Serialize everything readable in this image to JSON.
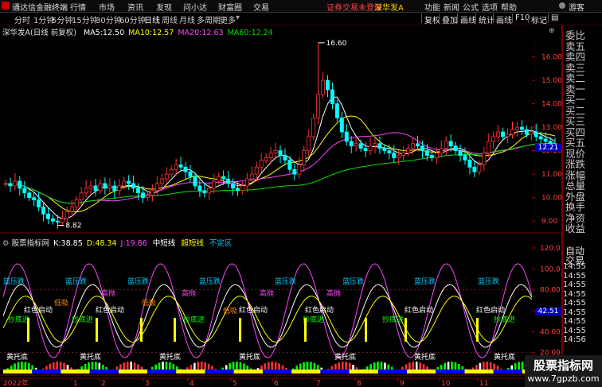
{
  "topbar": {
    "app_title": "通达信金融终端",
    "menus": [
      "行情",
      "市场",
      "资讯",
      "发现",
      "问小达",
      "财富圈",
      "交易"
    ],
    "notice": "证券交易未登录",
    "stock_short": "深华发A",
    "right_menus": [
      "功能",
      "新闻",
      "公式",
      "选项",
      "帮助",
      "游客"
    ]
  },
  "toolbar": {
    "periods": [
      "分时",
      "1分钟",
      "5分钟",
      "15分钟",
      "30分钟",
      "60分钟",
      "日线",
      "周线",
      "月线",
      "多周期",
      "更多"
    ],
    "active_period": "日线",
    "right_buttons": [
      "复权",
      "叠加",
      "画线",
      "统计",
      "画线",
      "F10",
      "标记"
    ]
  },
  "main_info": {
    "stock": "深华发A(日线 前复权)",
    "ma5_label": "MA5:",
    "ma5": "12.50",
    "ma10_label": "MA10:",
    "ma10": "12.57",
    "ma20_label": "MA20:",
    "ma20": "12.63",
    "ma60_label": "MA60:",
    "ma60": "12.24"
  },
  "sub_info": {
    "indicator": "股票指标网",
    "k_label": "K:",
    "k": "38.85",
    "d_label": "D:",
    "d": "48.34",
    "j_label": "J:",
    "j": "19.86",
    "mid": "中短线",
    "super": "超短线",
    "zone": "不定区"
  },
  "price_axis": [
    "16.00",
    "15.00",
    "14.00",
    "13.00",
    "12.00",
    "11.00",
    "10.00",
    "9.00"
  ],
  "kdj_axis": [
    "120.0",
    "100.0",
    "80.00",
    "60.00",
    "40.00",
    "20.00",
    "0.00"
  ],
  "current_price_tag": "12.21",
  "kdj_value_tag": "42.51",
  "high_label": "16.60",
  "low_label": "8.82",
  "date_axis": [
    "2022年",
    "1",
    "2",
    "3",
    "4",
    "5",
    "6",
    "7",
    "8",
    "9",
    "10",
    "11"
  ],
  "annotations": {
    "start": "红色启动",
    "low": "低吸",
    "top": "高抛",
    "lower_support": "黄托底",
    "pressure": "蓝压跌",
    "cut": "抄底进"
  },
  "right_panel": {
    "labels": [
      "委比",
      "卖五",
      "卖四",
      "卖三",
      "卖二",
      "卖一",
      "买一",
      "买二",
      "买三",
      "买四",
      "买五",
      "现价",
      "涨跌",
      "涨幅",
      "总量",
      "外盘",
      "换手",
      "净资",
      "收益"
    ],
    "bottom_labels": [
      "自动",
      "交易",
      "14:55",
      "14:55",
      "14:55",
      "14:55",
      "14:55",
      "14:55",
      "14:55",
      "14:55",
      "14:56"
    ]
  },
  "watermark": {
    "title": "股票指标网",
    "url": "www.7gpzb.com"
  },
  "chart_data": {
    "type": "candlestick",
    "title": "深华发A(日线 前复权)",
    "ylim": [
      8.6,
      16.9
    ],
    "x_categories": [
      "2022年",
      "1",
      "2",
      "3",
      "4",
      "5",
      "6",
      "7",
      "8",
      "9",
      "10",
      "11"
    ],
    "max_marker": 16.6,
    "min_marker": 8.82,
    "close_series": [
      10.6,
      10.5,
      10.7,
      10.4,
      10.2,
      10.0,
      9.9,
      9.6,
      9.3,
      9.1,
      9.0,
      8.95,
      9.1,
      9.4,
      9.6,
      9.9,
      10.2,
      10.4,
      10.5,
      10.3,
      10.6,
      10.4,
      10.5,
      10.3,
      10.5,
      10.7,
      10.6,
      10.4,
      10.2,
      10.0,
      10.1,
      10.3,
      10.6,
      10.8,
      11.0,
      11.2,
      11.4,
      11.3,
      11.1,
      10.9,
      10.5,
      10.3,
      10.2,
      10.4,
      10.7,
      10.9,
      10.8,
      10.6,
      10.4,
      10.3,
      10.5,
      10.8,
      11.0,
      11.3,
      11.6,
      11.7,
      11.9,
      12.0,
      11.8,
      11.6,
      11.2,
      11.0,
      11.4,
      12.0,
      12.6,
      13.4,
      14.4,
      15.0,
      14.6,
      14.0,
      13.4,
      12.8,
      12.4,
      12.2,
      12.3,
      12.1,
      12.0,
      12.2,
      12.3,
      12.1,
      12.0,
      11.9,
      11.7,
      11.8,
      11.9,
      12.1,
      12.3,
      12.2,
      12.0,
      11.8,
      11.7,
      11.9,
      12.1,
      12.4,
      12.2,
      12.0,
      11.8,
      11.6,
      11.3,
      11.1,
      11.4,
      11.9,
      12.4,
      12.6,
      12.8,
      12.6,
      12.7,
      12.9,
      13.0,
      12.9,
      12.7,
      12.8,
      12.6,
      12.5,
      12.4,
      12.3,
      12.2
    ],
    "ma_series": [
      {
        "name": "MA5",
        "color": "#ffffff",
        "value": 12.5
      },
      {
        "name": "MA10",
        "color": "#ffff00",
        "value": 12.57
      },
      {
        "name": "MA20",
        "color": "#ff44ff",
        "value": 12.63
      },
      {
        "name": "MA60",
        "color": "#00e000",
        "value": 12.24
      }
    ],
    "kdj": {
      "ylim": [
        0,
        120
      ],
      "K": 38.85,
      "D": 48.34,
      "J": 19.86
    }
  }
}
